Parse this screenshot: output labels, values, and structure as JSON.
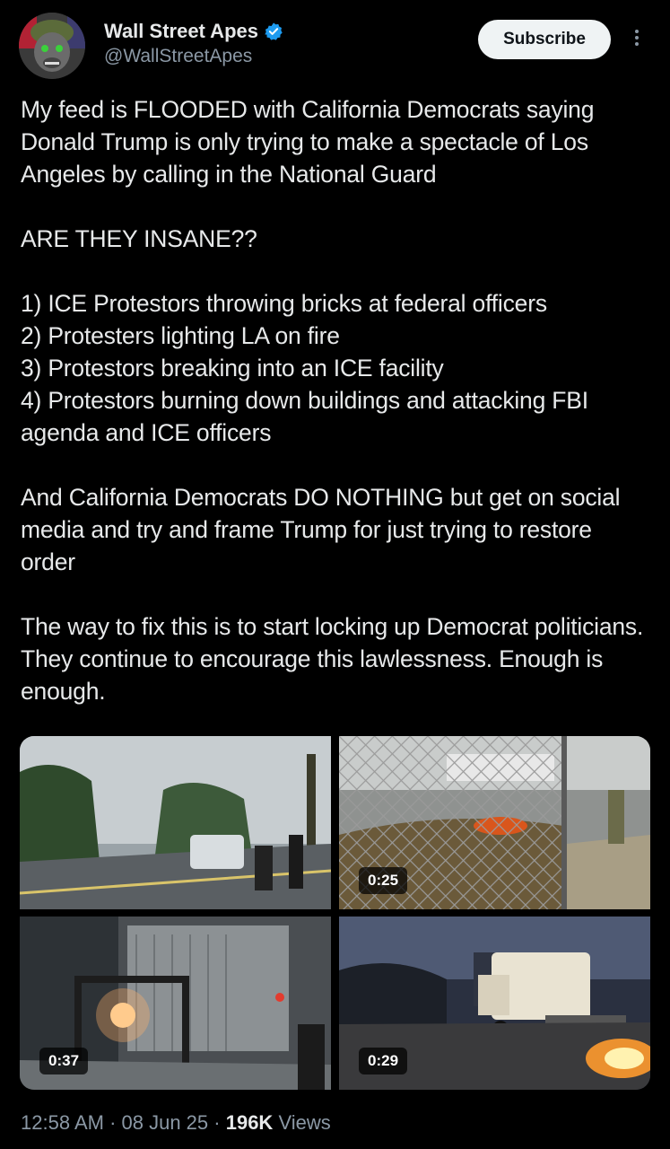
{
  "author": {
    "display_name": "Wall Street Apes",
    "handle": "@WallStreetApes",
    "verified": true,
    "avatar_icon": "ape-avatar-icon"
  },
  "actions": {
    "subscribe_label": "Subscribe",
    "more_icon": "more-vertical-icon"
  },
  "tweet": {
    "paragraphs": [
      "My feed is FLOODED with California Democrats saying Donald Trump is only trying to make a spectacle of Los Angeles by calling in the National Guard",
      "ARE THEY INSANE??",
      "1) ICE Protestors throwing bricks at federal officers",
      "2) Protesters lighting LA on fire",
      "3) Protestors breaking into an ICE facility",
      "4) Protestors burning down buildings and attacking FBI agenda and ICE officers",
      "And California Democrats DO NOTHING but get on social media and try and frame Trump for just trying to restore order",
      "The way to fix this is to start locking up Democrat politicians. They continue to encourage this lawlessness. Enough is enough."
    ]
  },
  "media": [
    {
      "name": "street-clash-video",
      "duration": ""
    },
    {
      "name": "fence-fire-video",
      "duration": "0:25"
    },
    {
      "name": "facility-fire-video",
      "duration": "0:37"
    },
    {
      "name": "burning-truck-video",
      "duration": "0:29"
    }
  ],
  "meta": {
    "time": "12:58 AM",
    "date": "08 Jun 25",
    "separator": " · ",
    "views_count": "196K",
    "views_label": "Views"
  },
  "colors": {
    "background": "#000000",
    "text": "#e7e9ea",
    "secondary": "#8b98a5",
    "verified": "#1d9bf0",
    "button_bg": "#eff3f4"
  }
}
